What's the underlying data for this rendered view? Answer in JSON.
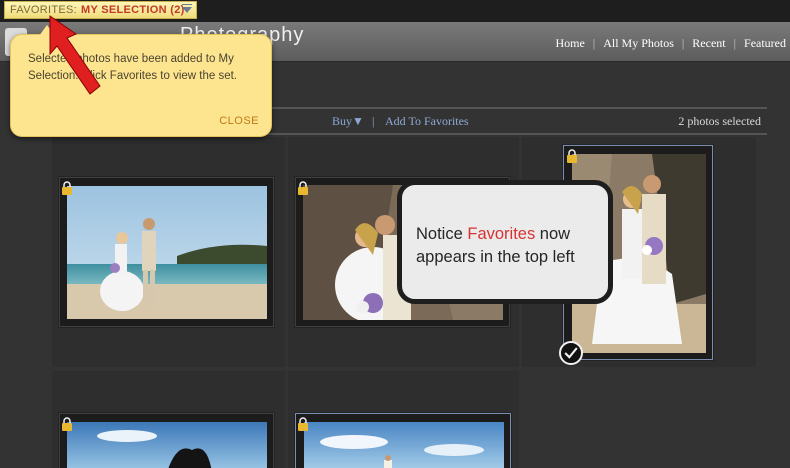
{
  "favorites_bar": {
    "label": "FAVORITES:",
    "selection": "MY SELECTION (2)"
  },
  "header": {
    "logo_text": "Photography",
    "nav": [
      {
        "label": "Home"
      },
      {
        "label": "All My Photos"
      },
      {
        "label": "Recent"
      },
      {
        "label": "Featured"
      }
    ]
  },
  "toolbar": {
    "buy_label": "Buy▼",
    "add_favorites_label": "Add To Favorites",
    "selected_count": "2 photos selected"
  },
  "tooltip": {
    "message": "Selected photos have been added to My Selection. Click Favorites to view the set.",
    "close_label": "CLOSE"
  },
  "callout": {
    "before": "Notice ",
    "highlight": "Favorites",
    "after": " now appears in the top left"
  },
  "colors": {
    "accent_link": "#8fa8d6",
    "favorites_highlight": "#d93232",
    "tooltip_bg": "#fde58f"
  },
  "photos": [
    {
      "name": "couple-beach",
      "selected": false,
      "locked": true
    },
    {
      "name": "couple-kiss-rocks",
      "selected": true,
      "locked": true
    },
    {
      "name": "couple-rocks-portrait",
      "selected": true,
      "locked": true
    },
    {
      "name": "silhouette-sky",
      "selected": false,
      "locked": true
    },
    {
      "name": "couple-sky",
      "selected": true,
      "locked": true
    }
  ]
}
